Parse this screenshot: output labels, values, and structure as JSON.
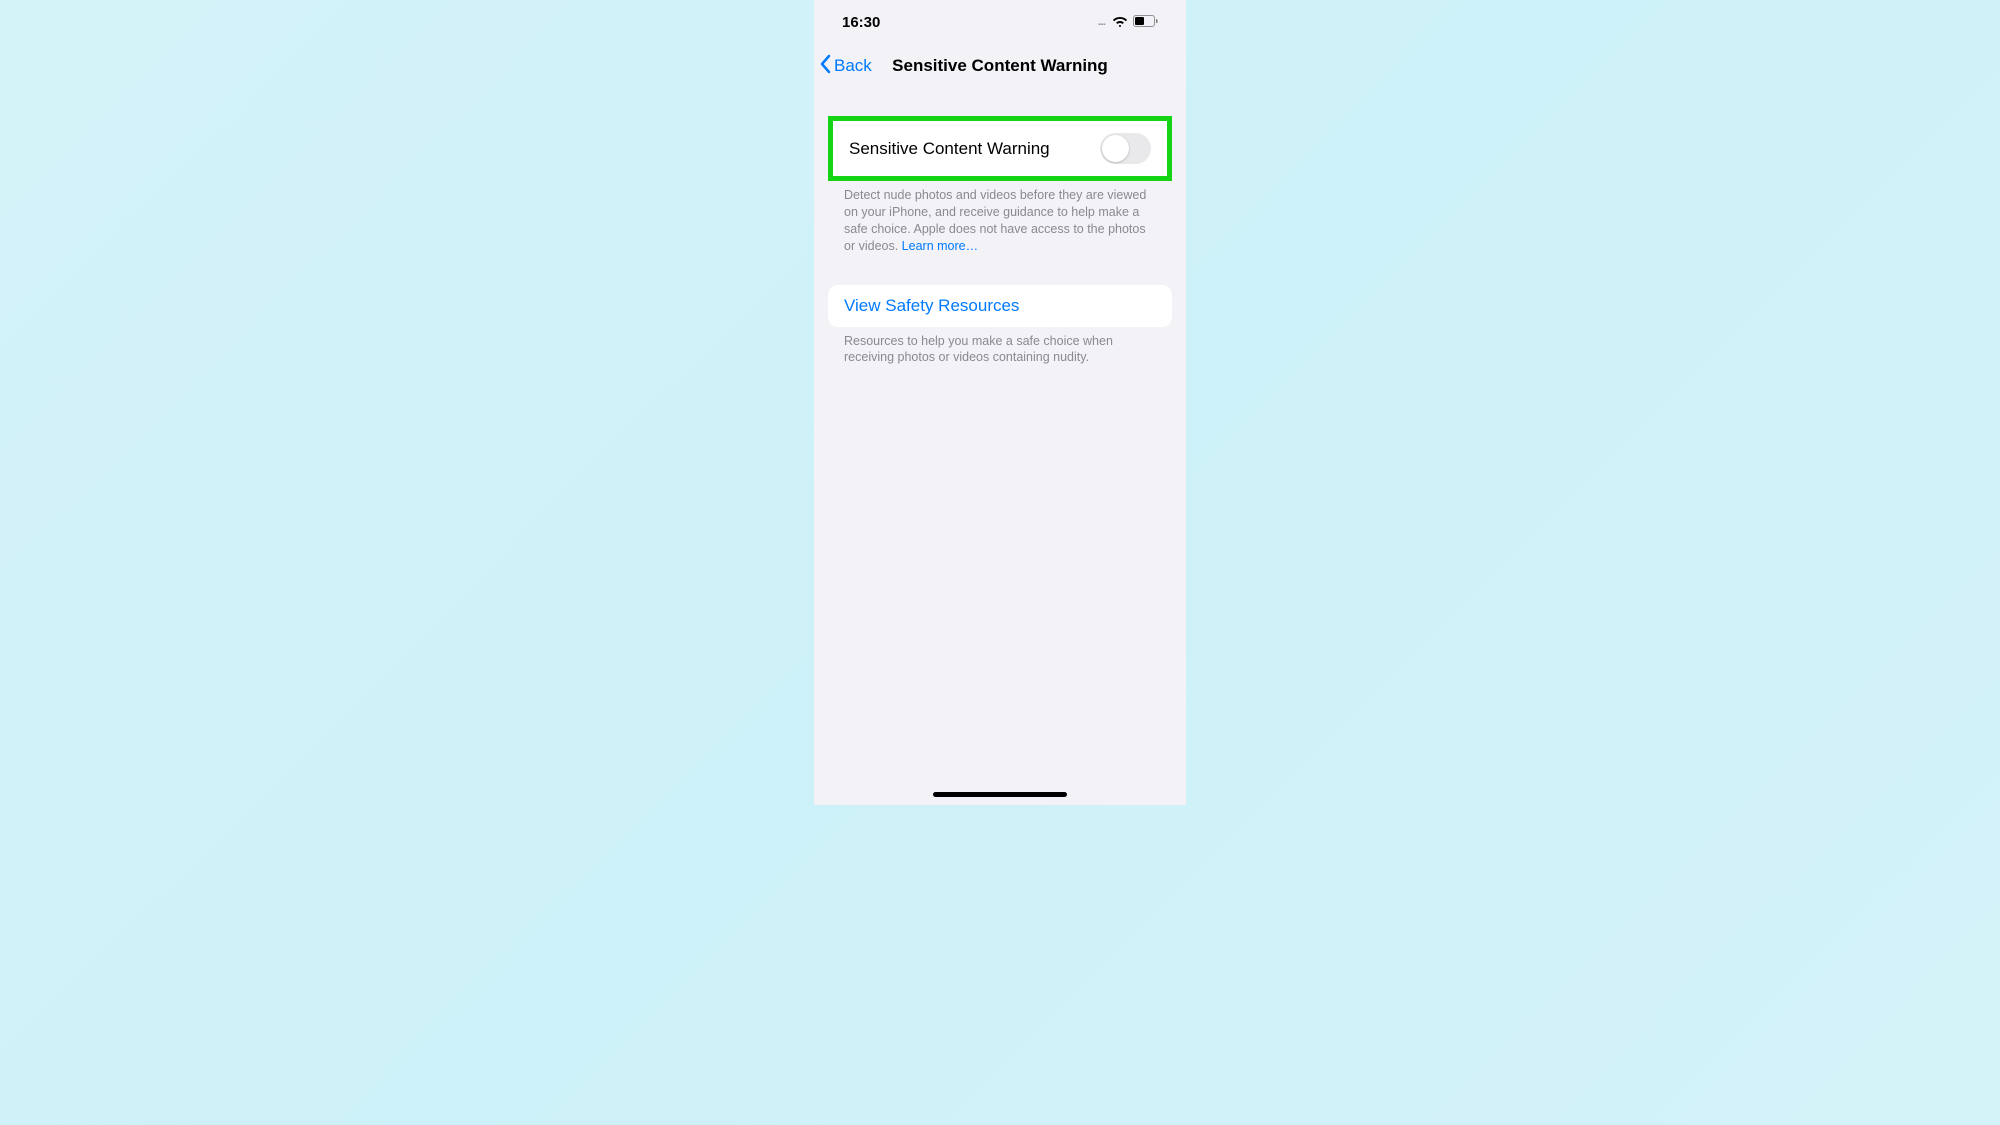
{
  "status": {
    "time": "16:30",
    "cellular_dots": "....",
    "icons": {
      "wifi": "wifi-icon",
      "battery": "battery-icon"
    }
  },
  "nav": {
    "back_label": "Back",
    "title": "Sensitive Content Warning"
  },
  "toggle_row": {
    "label": "Sensitive Content Warning",
    "value": false
  },
  "toggle_footer": {
    "text": "Detect nude photos and videos before they are viewed on your iPhone, and receive guidance to help make a safe choice. Apple does not have access to the photos or videos. ",
    "link": "Learn more…"
  },
  "resources_row": {
    "label": "View Safety Resources"
  },
  "resources_footer": {
    "text": "Resources to help you make a safe choice when receiving photos or videos containing nudity."
  },
  "colors": {
    "accent": "#007aff",
    "highlight": "#15d315",
    "background": "#f2f2f7"
  }
}
